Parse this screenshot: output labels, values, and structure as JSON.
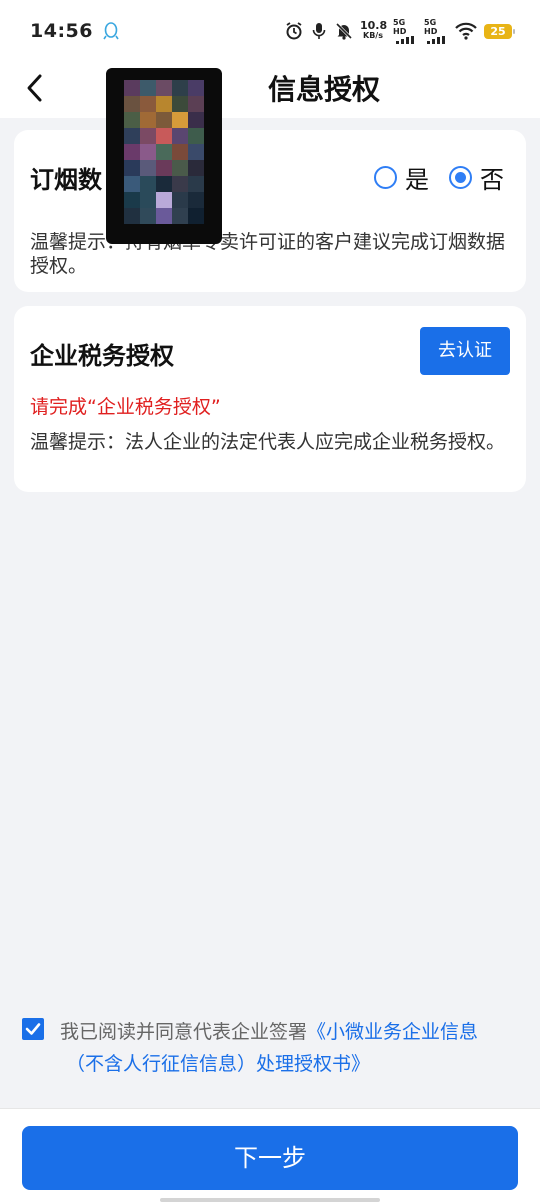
{
  "status_bar": {
    "time": "14:56",
    "net_speed_value": "10.8",
    "net_speed_unit": "KB/s",
    "sim1_label": "5G HD",
    "sim2_label": "5G HD",
    "battery_level": "25",
    "battery_color": "#e8b416"
  },
  "nav": {
    "title": "信息授权"
  },
  "card_tobacco": {
    "title": "订烟数",
    "option_yes": "是",
    "option_no": "否",
    "selected": "no",
    "tip": "温馨提示：持有烟草专卖许可证的客户建议完成订烟数据授权。"
  },
  "card_tax": {
    "title": "企业税务授权",
    "verify_button": "去认证",
    "warning": "请完成“企业税务授权”",
    "tip": "温馨提示：法人企业的法定代表人应完成企业税务授权。"
  },
  "agreement": {
    "checked": true,
    "prefix": "我已阅读并同意代表企业签署",
    "link_line1": "《小微业务企业信息",
    "link_line2": "（不含人行征信信息）处理授权书》"
  },
  "footer": {
    "next_button": "下一步"
  },
  "colors": {
    "accent": "#1a6fe8",
    "warning": "#e02020",
    "background": "#f2f3f6"
  }
}
